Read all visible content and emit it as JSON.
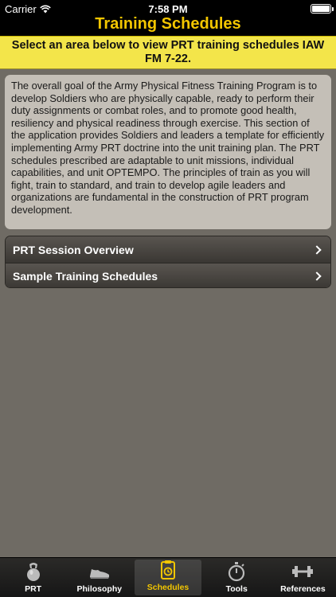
{
  "status_bar": {
    "carrier": "Carrier",
    "time": "7:58 PM"
  },
  "nav": {
    "title": "Training Schedules"
  },
  "banner": {
    "text": "Select an area below to view PRT training schedules IAW FM 7-22."
  },
  "intro": {
    "text": "The overall goal of the Army Physical Fitness Training Program is to develop Soldiers who are physically capable, ready to perform their duty assignments or combat roles, and to promote good health, resiliency and physical readiness through exercise. This section of the application provides Soldiers and leaders a template for efficiently implementing Army PRT doctrine into the unit training plan. The PRT schedules prescribed are adaptable to unit missions, individual capabilities, and unit OPTEMPO. The principles of train as you will fight, train to standard, and train to develop agile leaders and organizations are fundamental in the construction of PRT program development."
  },
  "menu": {
    "items": [
      {
        "label": "PRT Session Overview",
        "icon": "chevron-right-icon"
      },
      {
        "label": "Sample Training Schedules",
        "icon": "chevron-right-icon"
      }
    ]
  },
  "tabbar": {
    "tabs": [
      {
        "label": "PRT",
        "icon": "kettlebell-icon",
        "selected": false
      },
      {
        "label": "Philosophy",
        "icon": "running-shoe-icon",
        "selected": false
      },
      {
        "label": "Schedules",
        "icon": "clipboard-icon",
        "selected": true
      },
      {
        "label": "Tools",
        "icon": "stopwatch-icon",
        "selected": false
      },
      {
        "label": "References",
        "icon": "dumbbell-icon",
        "selected": false
      }
    ]
  },
  "colors": {
    "accent": "#f3c600",
    "banner": "#f3e54a",
    "background": "#6f6b64",
    "card": "#c4bfb7"
  }
}
